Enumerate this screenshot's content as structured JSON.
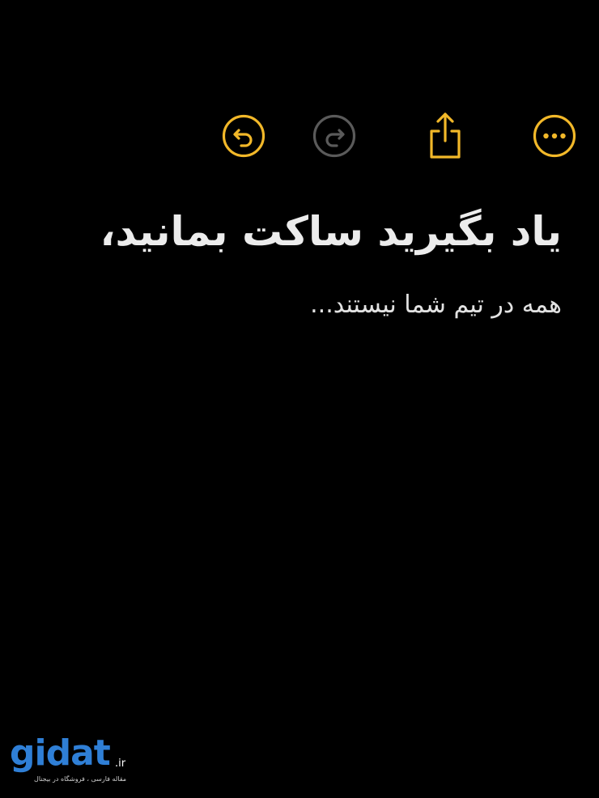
{
  "toolbar": {
    "accent_color": "#f2b829",
    "disabled_color": "#5a5a5a",
    "items": [
      {
        "icon": "undo-icon",
        "state": "enabled"
      },
      {
        "icon": "redo-icon",
        "state": "disabled"
      },
      {
        "icon": "share-icon",
        "state": "enabled"
      },
      {
        "icon": "more-icon",
        "state": "enabled"
      }
    ]
  },
  "note": {
    "title": "یاد بگیرید ساکت بمانید،",
    "body": "همه در تیم شما نیستند..."
  },
  "watermark": {
    "logo": "gidat",
    "tld": ".ir",
    "tagline": "مقاله فارسی ، فروشگاه در بیجنال",
    "brand_color": "#2f7fd6"
  }
}
